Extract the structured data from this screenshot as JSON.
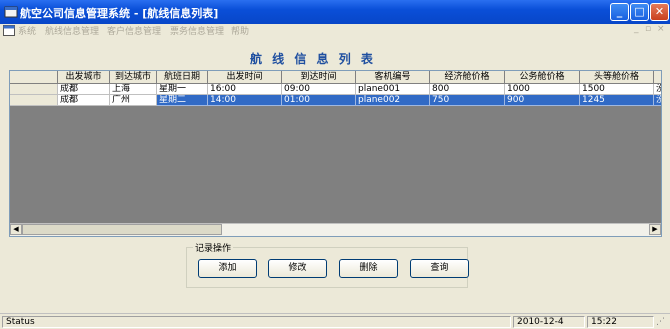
{
  "window": {
    "title": "航空公司信息管理系统 - [航线信息列表]"
  },
  "menubar": {
    "items": [
      "系统",
      "航线信息管理",
      "客户信息管理",
      "票务信息管理",
      "帮助"
    ]
  },
  "page": {
    "heading": "航 线 信 息 列 表"
  },
  "grid": {
    "columns": [
      "出发城市",
      "到达城市",
      "航班日期",
      "出发时间",
      "到达时间",
      "客机编号",
      "经济舱价格",
      "公务舱价格",
      "头等舱价格",
      "..."
    ],
    "rows": [
      [
        "成都",
        "上海",
        "星期一",
        "16:00",
        "09:00",
        "plane001",
        "800",
        "1000",
        "1500",
        "没"
      ],
      [
        "成都",
        "广州",
        "星期二",
        "14:00",
        "01:00",
        "plane002",
        "750",
        "900",
        "1245",
        "没"
      ]
    ],
    "selected_row": 1
  },
  "actions": {
    "group_label": "记录操作",
    "add": "添加",
    "edit": "修改",
    "delete": "删除",
    "query": "查询"
  },
  "status": {
    "text": "Status",
    "date": "2010-12-4",
    "time": "15:22"
  }
}
